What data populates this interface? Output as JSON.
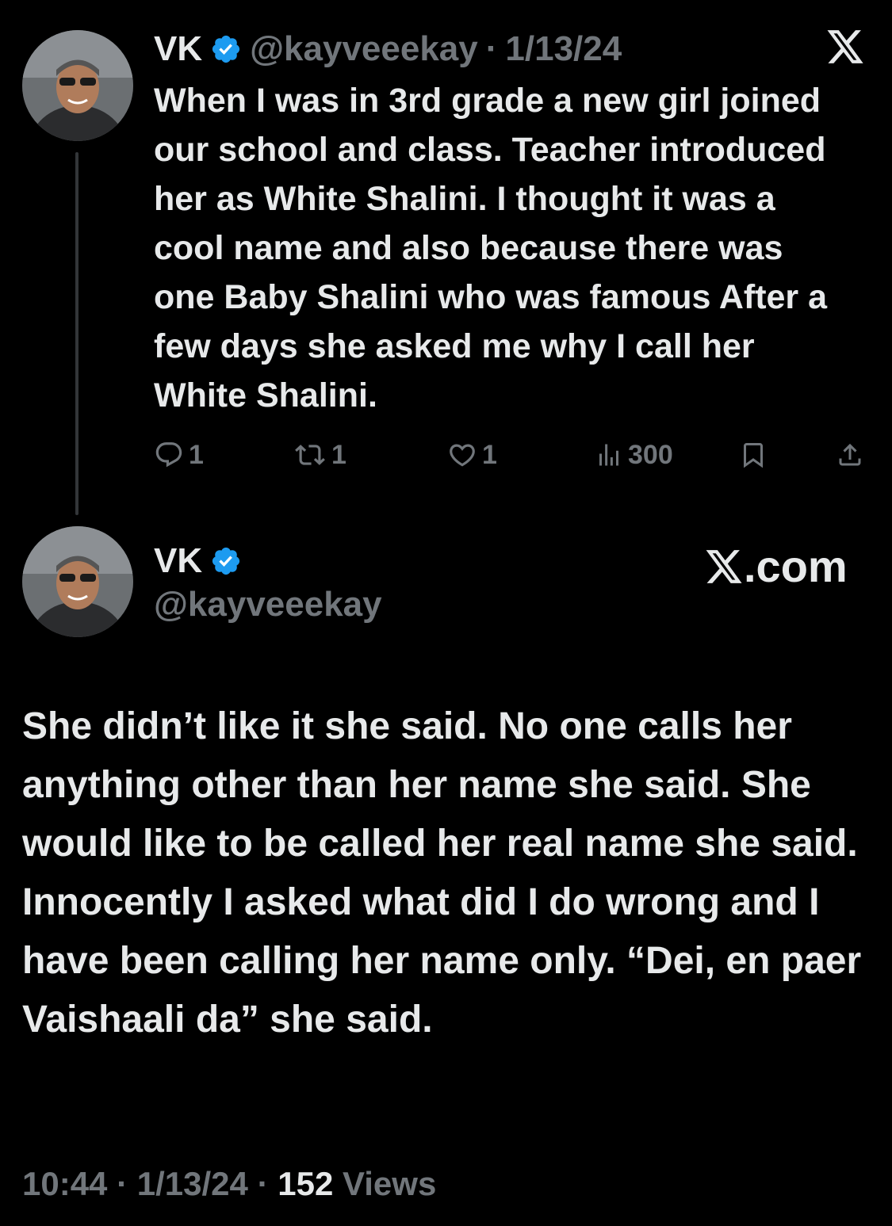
{
  "tweet1": {
    "display_name": "VK",
    "handle": "@kayveeekay",
    "separator": "·",
    "date": "1/13/24",
    "text": "When I was in 3rd grade a new girl joined our school and class. Teacher introduced her as White Shalini. I thought it was a cool name and also because there was one Baby Shalini who was famous After a few days she asked me why I call her White Shalini.",
    "stats": {
      "replies": "1",
      "reposts": "1",
      "likes": "1",
      "views": "300"
    }
  },
  "tweet2": {
    "display_name": "VK",
    "handle": "@kayveeekay",
    "brand_suffix": ".com",
    "text": "She didn’t like it she said. No one calls her anything other than her name she said. She would like to be called her real name she said. Innocently I asked what did I do wrong and I have been calling her name only. “Dei, en paer Vaishaali da” she said.",
    "time": "10:44",
    "date": "1/13/24",
    "sep1": "·",
    "sep2": "·",
    "views_count": "152",
    "views_label": "Views"
  },
  "icons": {
    "verified": "verified-badge-icon",
    "x_logo": "x-logo-icon",
    "reply": "reply-icon",
    "repost": "repost-icon",
    "like": "heart-icon",
    "views": "views-chart-icon",
    "bookmark": "bookmark-icon",
    "share": "share-icon"
  },
  "colors": {
    "background": "#000000",
    "text": "#e7e9ea",
    "muted": "#71767b",
    "verified_blue": "#1d9bf0",
    "thread_line": "#333639"
  }
}
